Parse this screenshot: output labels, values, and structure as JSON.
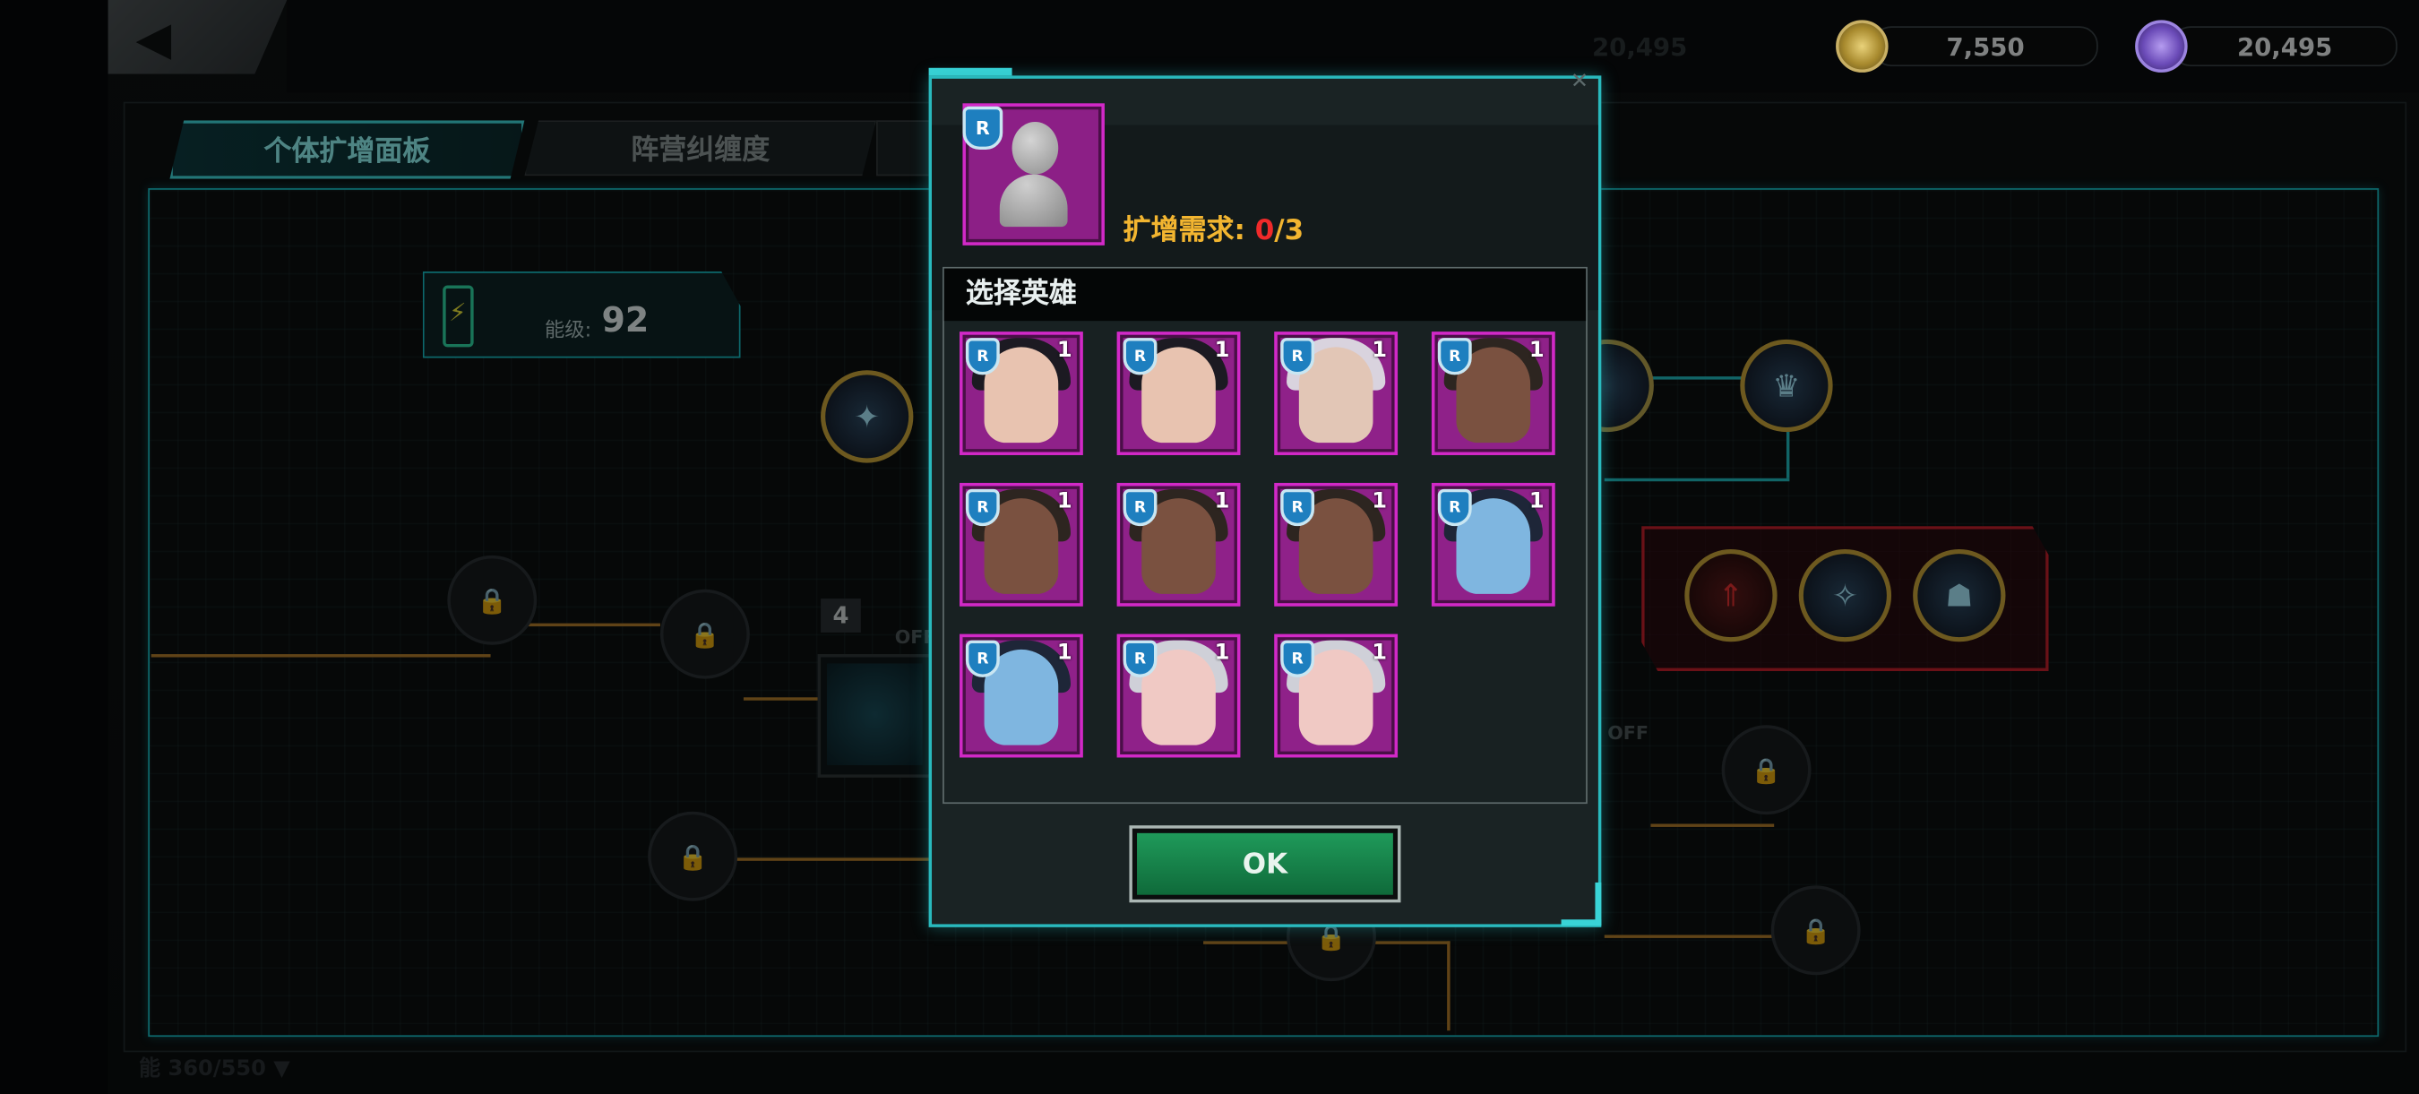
{
  "tabs": [
    {
      "label": "个体扩增面板",
      "active": true
    },
    {
      "label": "阵营纠缠度",
      "active": false
    }
  ],
  "resources": {
    "gold": "7,550",
    "crystal": "20,495",
    "faded": "20,495"
  },
  "energy": {
    "label": "能级:",
    "value": "92"
  },
  "board": {
    "stack_badge": "4",
    "off_labels": [
      "OFF",
      "OFF"
    ],
    "bottom_text": "能 360/550 ▼"
  },
  "modal": {
    "requirement_label": "扩增需求: ",
    "requirement_current": "0",
    "requirement_total": "/3",
    "select_title": "选择英雄",
    "ok_label": "OK",
    "close_icon": "close-icon"
  },
  "heroes": [
    {
      "count": "1",
      "variant": "dark-hair-woman"
    },
    {
      "count": "1",
      "variant": "dark-hair-woman"
    },
    {
      "count": "1",
      "variant": "white-hair-man"
    },
    {
      "count": "1",
      "variant": "green-eye-woman"
    },
    {
      "count": "1",
      "variant": "green-eye-woman"
    },
    {
      "count": "1",
      "variant": "green-eye-woman"
    },
    {
      "count": "1",
      "variant": "green-eye-woman"
    },
    {
      "count": "1",
      "variant": "blue-skin-woman"
    },
    {
      "count": "1",
      "variant": "blue-skin-woman"
    },
    {
      "count": "1",
      "variant": "silver-hair-woman"
    },
    {
      "count": "1",
      "variant": "silver-hair-woman"
    }
  ],
  "colors": {
    "accent_cyan": "#29b9bd",
    "rarity_purple": "#d129c7",
    "requirement_gold": "#f2b530",
    "requirement_red": "#f02a2a",
    "ok_green": "#1f9a5a"
  }
}
